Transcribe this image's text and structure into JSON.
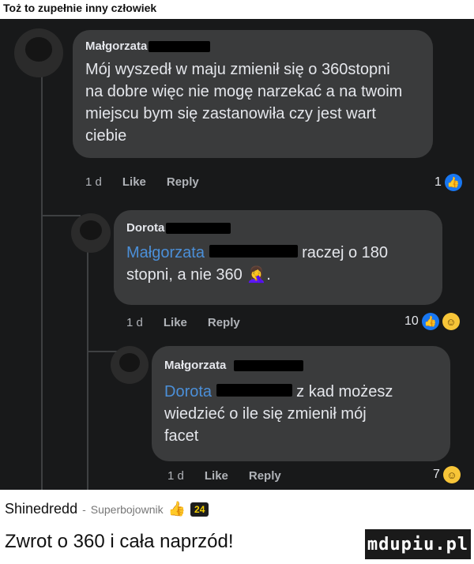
{
  "caption_top": "Toż to zupełnie inny człowiek",
  "comments": [
    {
      "author": "Małgorzata",
      "text": "Mój wyszedł w maju zmienił się o 360stopni na dobre więc nie mogę narzekać a na twoim miejscu bym się zastanowiła czy jest wart ciebie",
      "time": "1 d",
      "like": "Like",
      "reply": "Reply",
      "reactions": "1"
    },
    {
      "author": "Dorota",
      "mention": "Małgorzata",
      "text_after_mention": "raczej o 180",
      "text_line2": "stopni, a nie 360",
      "emoji": "🤦‍♀️",
      "trail": ".",
      "time": "1 d",
      "like": "Like",
      "reply": "Reply",
      "reactions": "10"
    },
    {
      "author": "Małgorzata",
      "mention": "Dorota",
      "text_after_mention": "z kad możesz",
      "text_line2": "wiedzieć o ile się zmienił mój",
      "text_line3": "facet",
      "time": "1 d",
      "like": "Like",
      "reply": "Reply",
      "reactions": "7"
    }
  ],
  "reaction_icons": {
    "like": "like-icon",
    "haha": "haha-icon"
  },
  "footer": {
    "user": "Shinedredd",
    "separator": "-",
    "role": "Superbojownik",
    "score": "24"
  },
  "caption_bottom": "Zwrot o 360 i cała naprzód!",
  "watermark": "mdupiu.pl",
  "colors": {
    "dark_bg": "#18191a",
    "bubble": "#3a3b3c",
    "mention": "#4b8fd8",
    "like_blue": "#1877f2"
  }
}
